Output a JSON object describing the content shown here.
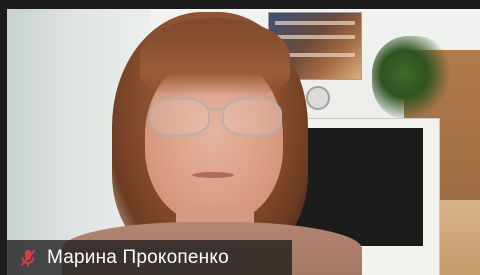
{
  "participant": {
    "name": "Марина Прокопенко"
  },
  "icons": {
    "mic": "microphone-muted-icon"
  },
  "colors": {
    "muted_mic": "#e03c3c",
    "name_text": "#ffffff",
    "name_bar_bg": "#1c1c1c"
  }
}
